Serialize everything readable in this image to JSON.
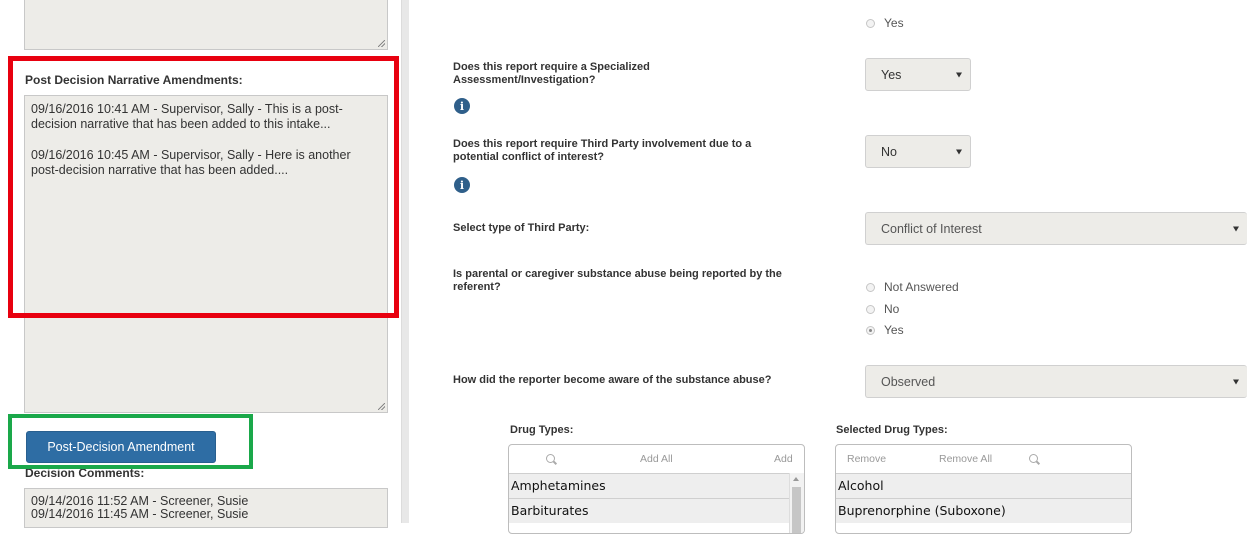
{
  "left": {
    "amendments_label": "Post Decision Narrative Amendments:",
    "amendments": [
      "09/16/2016 10:41 AM - Supervisor, Sally - This is a post-decision narrative that has been added to this intake...",
      "09/16/2016 10:45 AM - Supervisor, Sally - Here is another post-decision narrative that has been added...."
    ],
    "amend_button_label": "Post-Decision Amendment",
    "decision_comments_label": "Decision Comments:",
    "decision_comments": [
      "09/14/2016 11:52 AM - Screener, Susie",
      "09/14/2016 11:45 AM - Screener, Susie"
    ]
  },
  "form": {
    "top_radio_yes": "Yes",
    "specialized": {
      "question": "Does this report require a Specialized Assessment/Investigation?",
      "value": "Yes"
    },
    "third_party": {
      "question": "Does this report require Third Party involvement due to a potential conflict of interest?",
      "value": "No"
    },
    "third_party_type": {
      "question": "Select type of Third Party:",
      "value": "Conflict of Interest"
    },
    "substance_abuse": {
      "question": "Is parental or caregiver substance abuse being reported by the referent?",
      "options": [
        "Not Answered",
        "No",
        "Yes"
      ],
      "selected": "Yes"
    },
    "awareness": {
      "question": "How did the reporter become aware of the substance abuse?",
      "value": "Observed"
    },
    "drug_types": {
      "label": "Drug Types:",
      "add_all": "Add All",
      "add": "Add",
      "items": [
        "Amphetamines",
        "Barbiturates"
      ]
    },
    "selected_drug_types": {
      "label": "Selected Drug Types:",
      "remove": "Remove",
      "remove_all": "Remove All",
      "items": [
        "Alcohol",
        "Buprenorphine (Suboxone)"
      ]
    }
  },
  "colors": {
    "highlight_red": "#e8000f",
    "highlight_green": "#1aa84a",
    "primary_button": "#2e6da4",
    "info_icon": "#2f5f8a"
  }
}
